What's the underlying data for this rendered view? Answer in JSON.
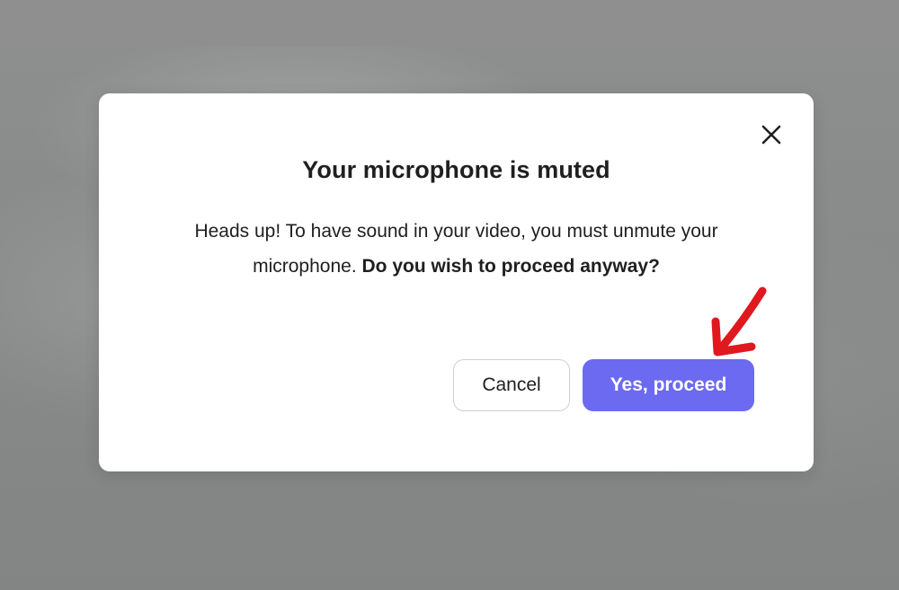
{
  "dialog": {
    "title": "Your microphone is muted",
    "message_lead": "Heads up! To have sound in your video, you must unmute your microphone.",
    "message_emphasis": "Do you wish to proceed anyway?",
    "cancel_label": "Cancel",
    "confirm_label": "Yes, proceed",
    "close_icon": "close-icon"
  },
  "colors": {
    "confirm_button": "#6c6af0",
    "annotation_arrow": "#e0191f",
    "backdrop": "#8a8c8c"
  },
  "annotation": {
    "icon": "red-arrow-annotation",
    "points_to": "confirm-button"
  }
}
